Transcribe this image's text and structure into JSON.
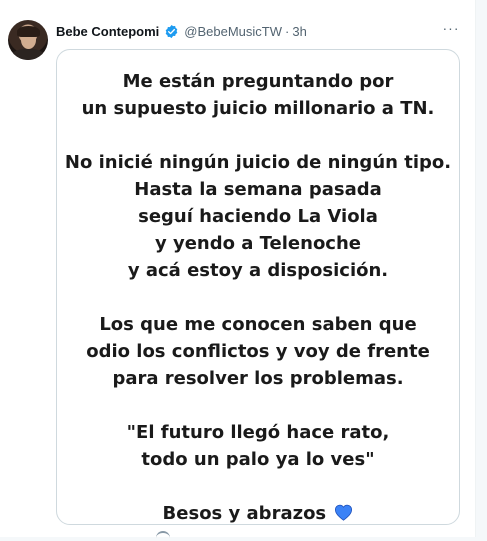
{
  "tweet": {
    "author_name": "Bebe Contepomi",
    "handle": "@BebeMusicTW",
    "separator": "·",
    "time": "3h",
    "more_label": "···",
    "verified_color": "#1d9bf0"
  },
  "media": {
    "paragraphs": [
      [
        "Me están preguntando por",
        "un supuesto juicio millonario a TN."
      ],
      [
        "No inicié ningún juicio de ningún tipo.",
        "Hasta la semana pasada",
        "seguí haciendo La Viola",
        "y yendo a Telenoche",
        "y acá estoy a disposición."
      ],
      [
        "Los que me conocen saben que",
        "odio los conflictos y voy de frente",
        "para resolver los problemas."
      ],
      [
        "\"El futuro llegó hace rato,",
        "todo un palo ya lo ves\""
      ]
    ],
    "closing": "Besos y abrazos",
    "closing_icon": "blue-heart-icon",
    "heart_color": "#3b82f6"
  }
}
